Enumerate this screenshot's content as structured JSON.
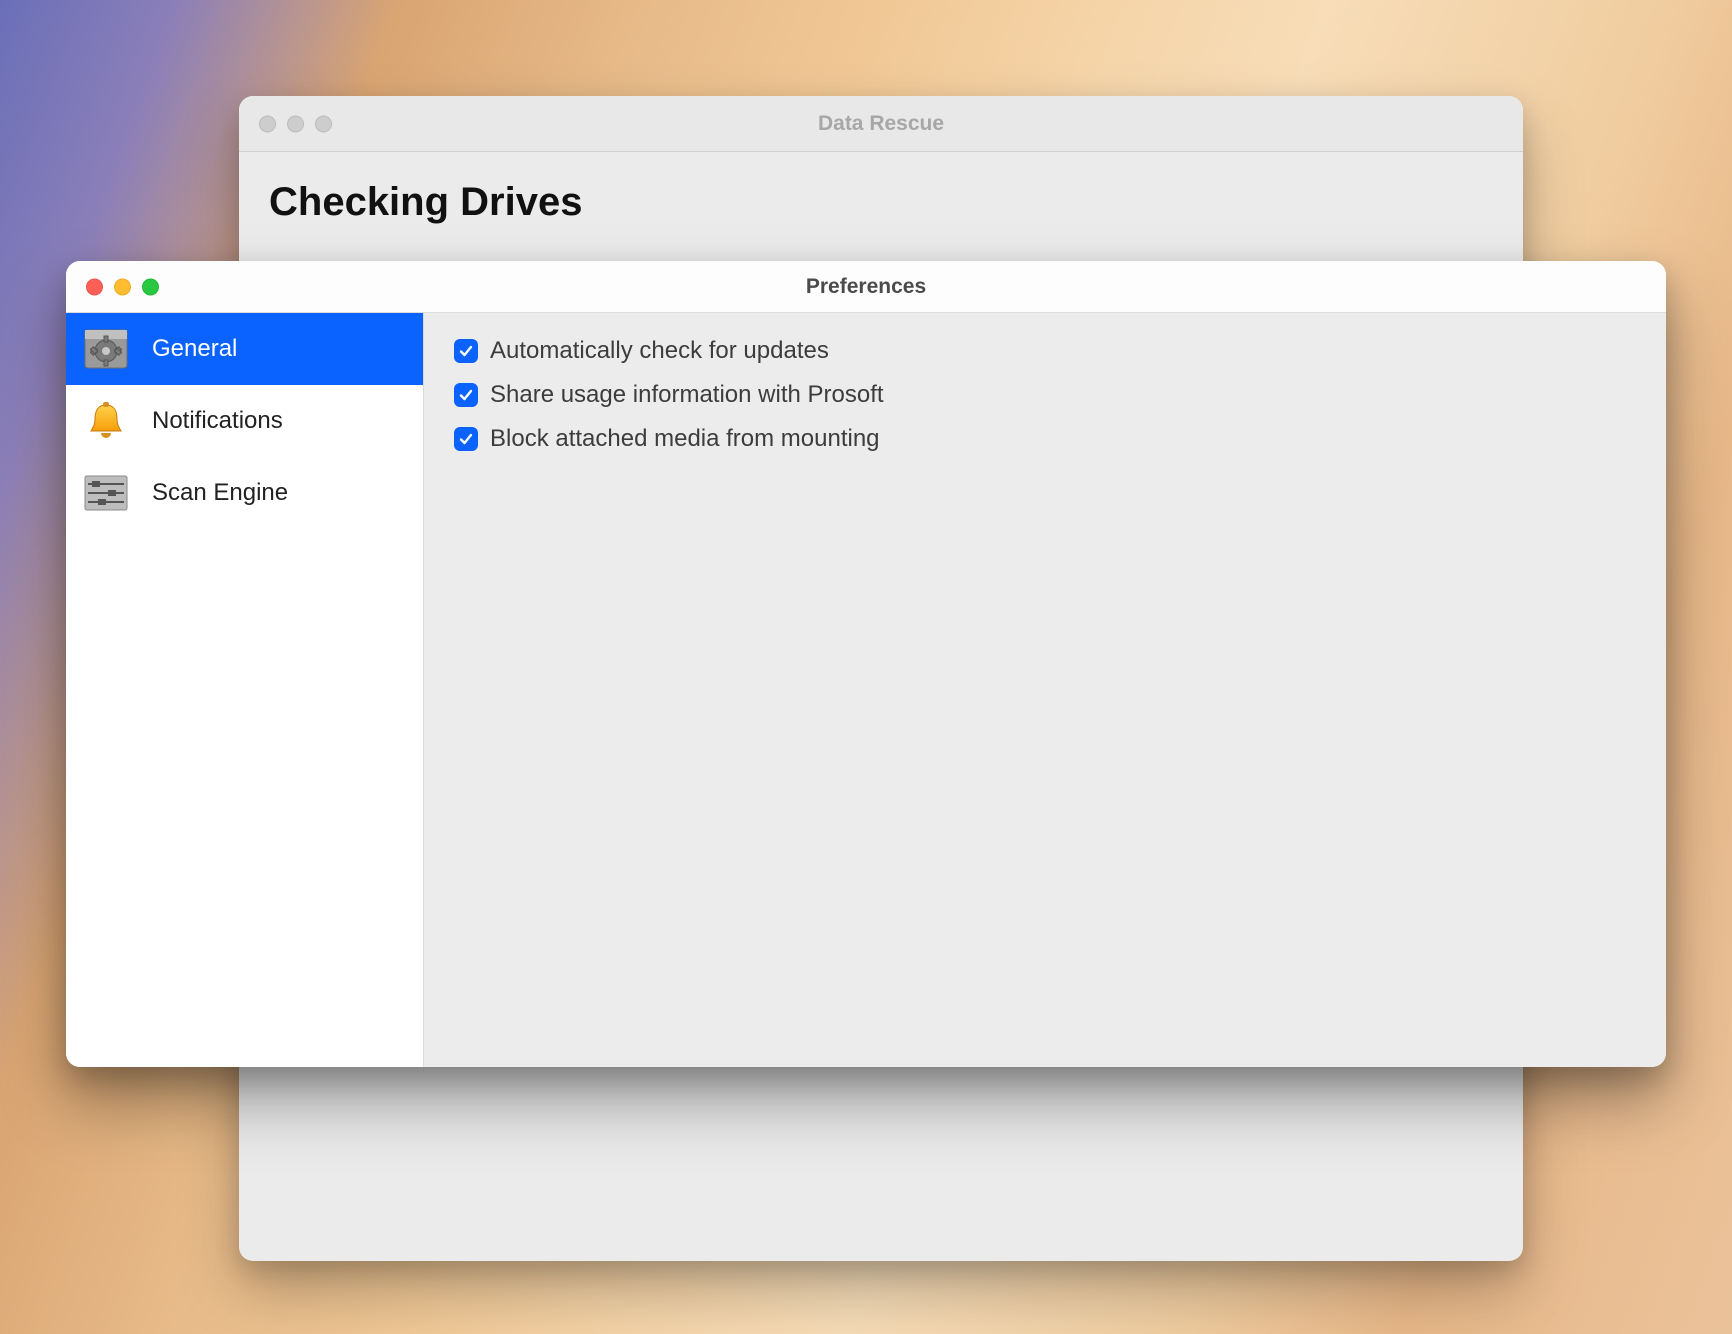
{
  "backWindow": {
    "title": "Data Rescue",
    "heading": "Checking Drives"
  },
  "preferences": {
    "title": "Preferences",
    "sidebar": {
      "items": [
        {
          "label": "General",
          "icon": "general-icon",
          "selected": true
        },
        {
          "label": "Notifications",
          "icon": "bell-icon",
          "selected": false
        },
        {
          "label": "Scan Engine",
          "icon": "scan-icon",
          "selected": false
        }
      ]
    },
    "general": {
      "options": [
        {
          "label": "Automatically check for updates",
          "checked": true
        },
        {
          "label": "Share usage information with Prosoft",
          "checked": true
        },
        {
          "label": "Block attached media from mounting",
          "checked": true
        }
      ]
    }
  },
  "colors": {
    "accent": "#0a63ff"
  }
}
